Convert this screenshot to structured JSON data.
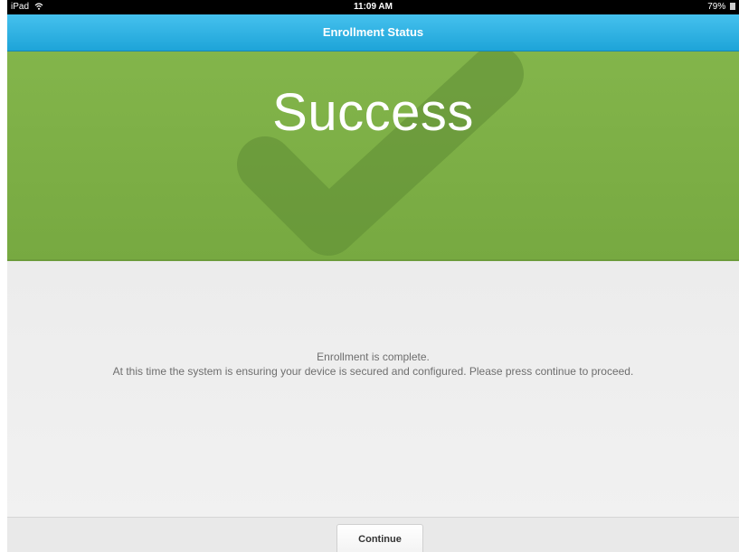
{
  "status_bar": {
    "device": "iPad",
    "wifi_icon": "wifi-icon",
    "time": "11:09 AM",
    "battery": "79%",
    "battery_icon": "battery-icon"
  },
  "nav": {
    "title": "Enrollment Status"
  },
  "banner": {
    "title": "Success",
    "icon": "check-icon",
    "color": "#7db046"
  },
  "content": {
    "line1": "Enrollment is complete.",
    "line2": "At this time the system is ensuring your device is secured and configured. Please press continue to proceed."
  },
  "footer": {
    "continue_label": "Continue"
  },
  "colors": {
    "nav": "#2aaee0",
    "banner": "#7db046"
  }
}
